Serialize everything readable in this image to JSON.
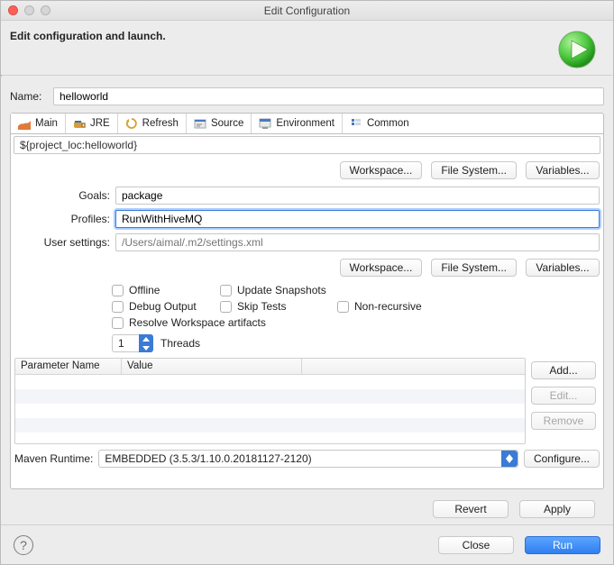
{
  "window": {
    "title": "Edit Configuration"
  },
  "header": {
    "title": "Edit configuration and launch."
  },
  "name": {
    "label": "Name:",
    "value": "helloworld"
  },
  "tabs": [
    {
      "label": "Main"
    },
    {
      "label": "JRE"
    },
    {
      "label": "Refresh"
    },
    {
      "label": "Source"
    },
    {
      "label": "Environment"
    },
    {
      "label": "Common"
    }
  ],
  "main": {
    "project_loc": "${project_loc:helloworld}",
    "buttons": {
      "workspace": "Workspace...",
      "filesystem": "File System...",
      "variables": "Variables..."
    },
    "goals_label": "Goals:",
    "goals": "package",
    "profiles_label": "Profiles:",
    "profiles": "RunWithHiveMQ",
    "user_settings_label": "User settings:",
    "user_settings": "/Users/aimal/.m2/settings.xml",
    "checks": {
      "offline": "Offline",
      "update_snapshots": "Update Snapshots",
      "debug_output": "Debug Output",
      "skip_tests": "Skip Tests",
      "non_recursive": "Non-recursive",
      "resolve_workspace": "Resolve Workspace artifacts"
    },
    "threads_value": "1",
    "threads_label": "Threads",
    "param_headers": {
      "name": "Parameter Name",
      "value": "Value"
    },
    "param_buttons": {
      "add": "Add...",
      "edit": "Edit...",
      "remove": "Remove"
    },
    "runtime_label": "Maven Runtime:",
    "runtime_value": "EMBEDDED (3.5.3/1.10.0.20181127-2120)",
    "configure": "Configure..."
  },
  "apply": {
    "revert": "Revert",
    "apply": "Apply"
  },
  "footer": {
    "close": "Close",
    "run": "Run"
  }
}
